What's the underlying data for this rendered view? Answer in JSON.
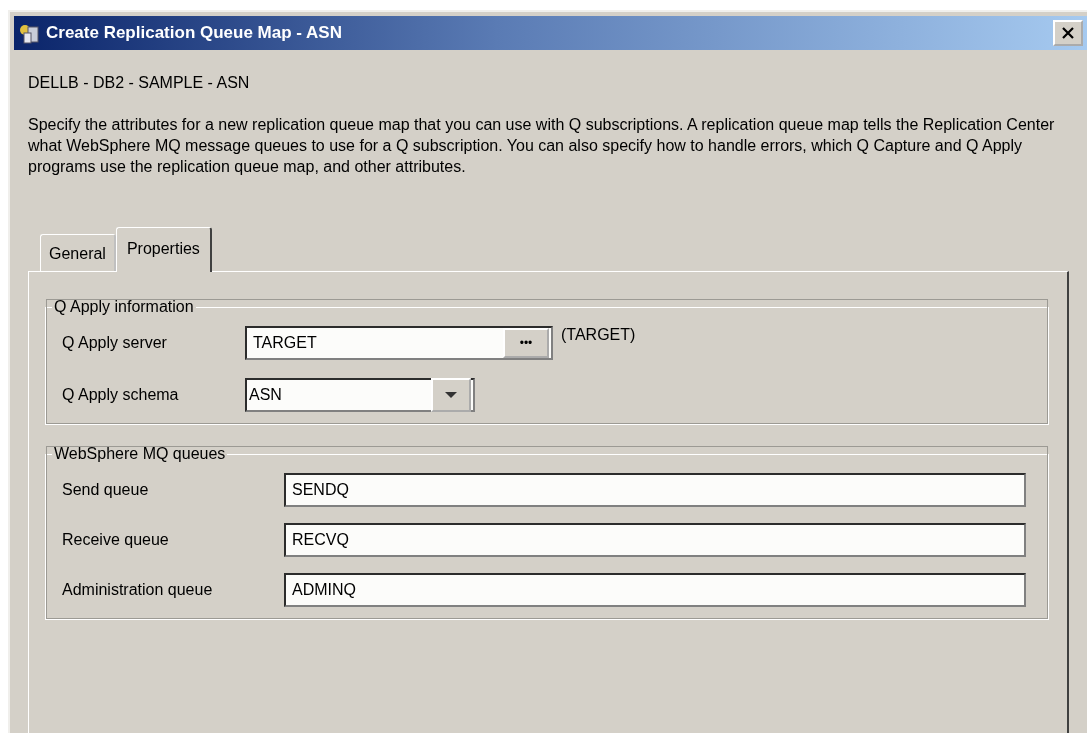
{
  "window": {
    "title": "Create Replication Queue Map - ASN"
  },
  "breadcrumb": "DELLB - DB2 - SAMPLE - ASN",
  "description": "Specify the attributes for a new replication queue map that you can use with Q subscriptions. A replication queue map tells the Replication Center what WebSphere MQ message queues to use for a Q subscription. You can also specify how to handle errors, which Q Capture and Q Apply programs use the replication queue map, and other attributes.",
  "tabs": [
    {
      "label": "General",
      "selected": false
    },
    {
      "label": "Properties",
      "selected": true
    }
  ],
  "q_apply_information": {
    "title": "Q Apply information",
    "server": {
      "label": "Q Apply server",
      "value": "TARGET",
      "button": "•••",
      "note": "(TARGET)"
    },
    "schema": {
      "label": "Q Apply schema",
      "value": "ASN"
    }
  },
  "websphere_mq_queues": {
    "title": "WebSphere MQ queues",
    "fields": [
      {
        "label": "Send queue",
        "value": "SENDQ"
      },
      {
        "label": "Receive queue",
        "value": "RECVQ"
      },
      {
        "label": "Administration queue",
        "value": "ADMINQ"
      }
    ]
  }
}
